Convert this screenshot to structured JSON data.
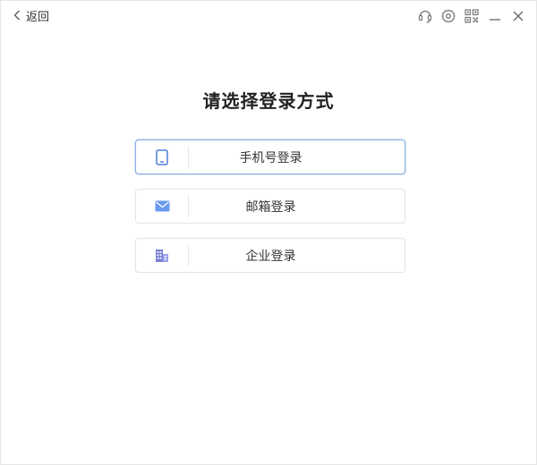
{
  "topbar": {
    "back_label": "返回",
    "icons": [
      "headset-icon",
      "settings-icon",
      "qrcode-icon",
      "minimize-icon",
      "close-icon"
    ]
  },
  "main": {
    "title": "请选择登录方式",
    "options": [
      {
        "label": "手机号登录",
        "icon": "phone-icon"
      },
      {
        "label": "邮箱登录",
        "icon": "mail-icon"
      },
      {
        "label": "企业登录",
        "icon": "building-icon"
      }
    ]
  },
  "colors": {
    "icon_blue": "#4e7ed6",
    "active_border": "#8fb0e3",
    "mail_blue": "#6a9af0",
    "building_purple": "#7a7fd6"
  }
}
